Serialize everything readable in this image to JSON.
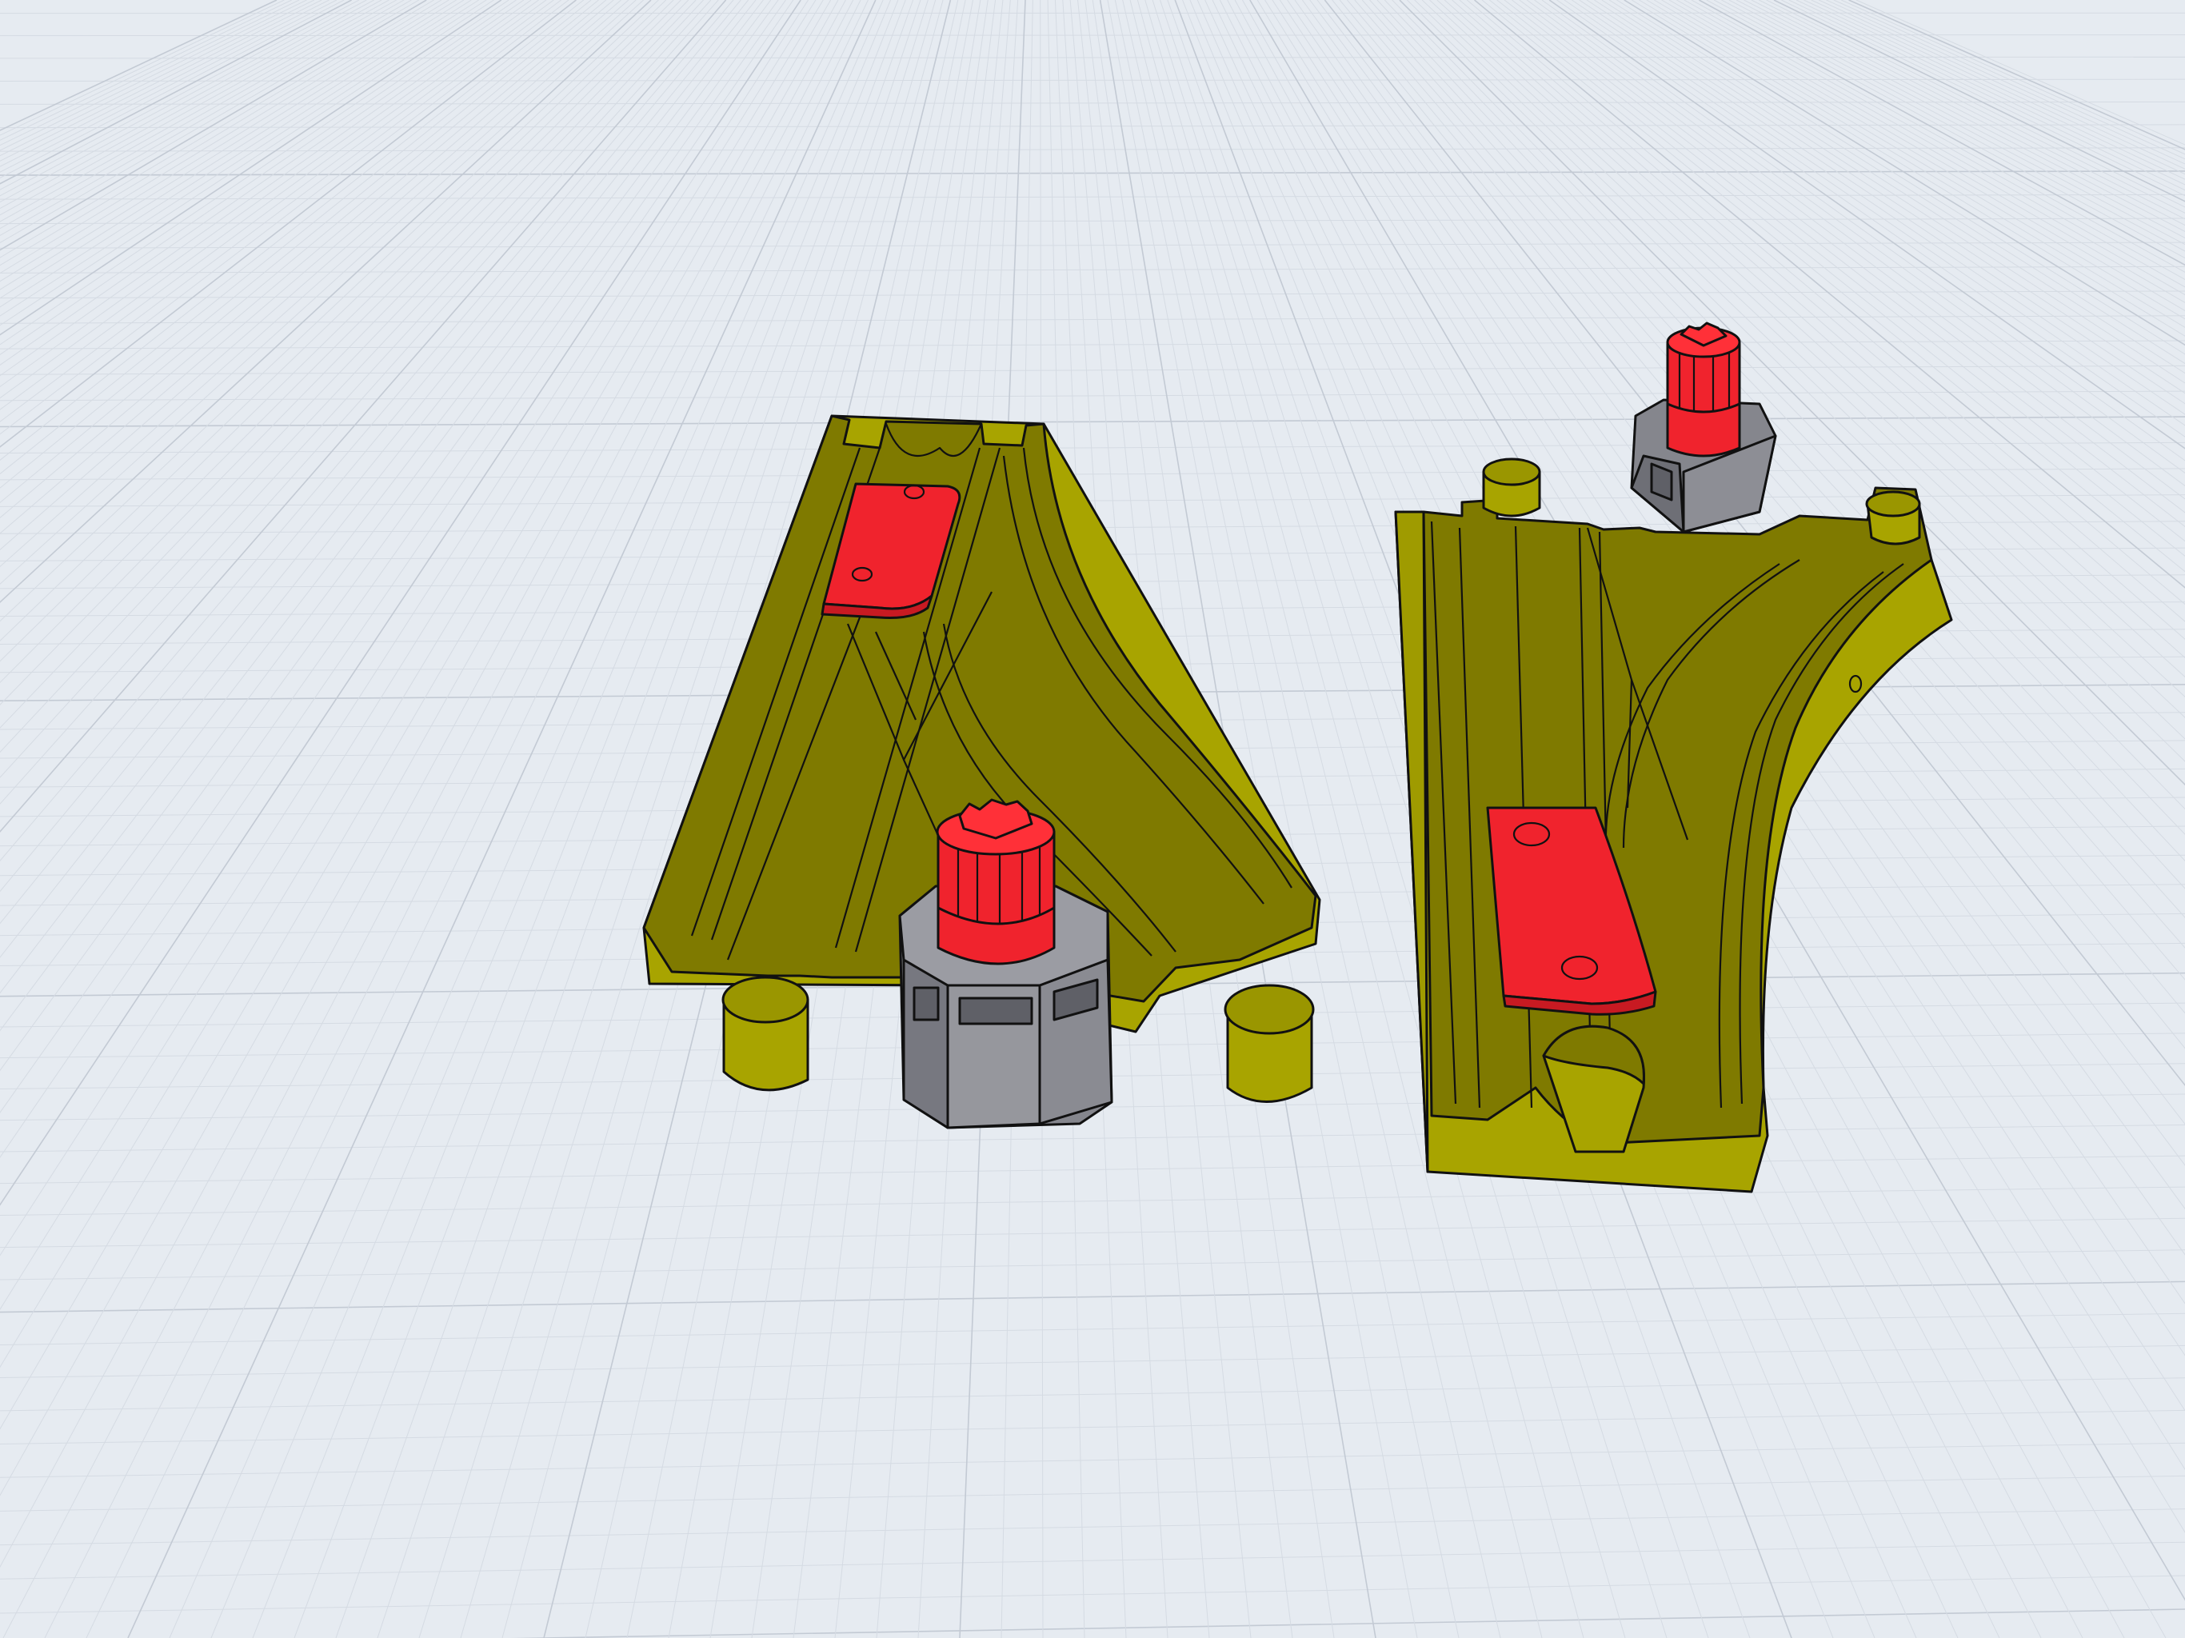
{
  "viewport": {
    "background_color": "#e6ebf1",
    "grid_minor_color": "#d5dbe3",
    "grid_major_color": "#c3cad4"
  },
  "scene": {
    "parts": [
      {
        "name": "left-switch-track",
        "color": "#7f7a00",
        "side_color": "#a8a400"
      },
      {
        "name": "right-switch-track",
        "color": "#7f7a00",
        "side_color": "#a8a400"
      }
    ],
    "accent_color": "#f0232d",
    "knob_color": "#f0232d",
    "housing_color": "#85868d",
    "outline_color": "#111111"
  }
}
